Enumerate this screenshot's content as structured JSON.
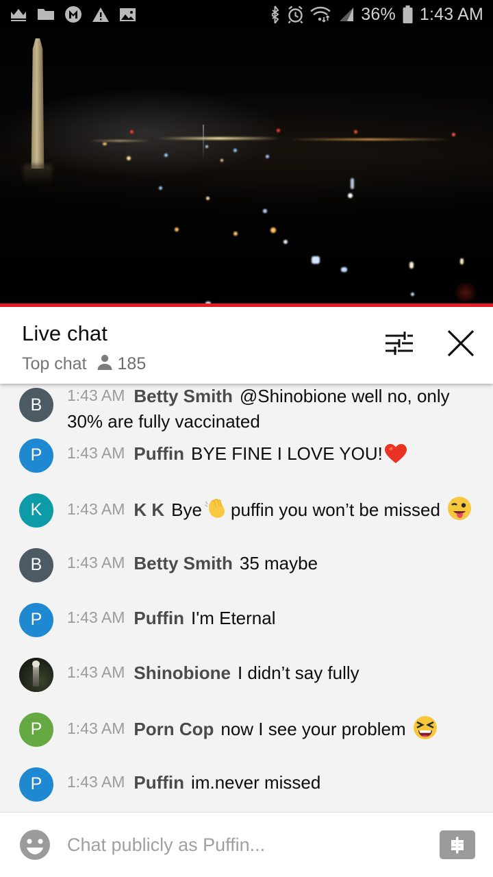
{
  "status_bar": {
    "left_icons": [
      {
        "name": "crown-icon",
        "label": "crown"
      },
      {
        "name": "folder-icon",
        "label": "folder"
      },
      {
        "name": "gmail-icon",
        "label": "M"
      },
      {
        "name": "warning-icon",
        "label": "warning"
      },
      {
        "name": "image-icon",
        "label": "image"
      }
    ],
    "right_icons": [
      {
        "name": "bluetooth-icon",
        "label": "bluetooth"
      },
      {
        "name": "alarm-icon",
        "label": "alarm"
      },
      {
        "name": "wifi-icon",
        "label": "wifi"
      },
      {
        "name": "signal-icon",
        "label": "signal"
      }
    ],
    "battery_percent": "36%",
    "time": "1:43 AM",
    "icon_color": "#b9b9b9",
    "background": "#000000"
  },
  "video": {
    "progress_bar_color": "#ec1d24",
    "description": "night skyline with Washington Monument"
  },
  "chat_header": {
    "title": "Live chat",
    "mode": "Top chat",
    "viewer_count": "185",
    "viewer_icon": "person-icon",
    "settings_icon": "tune-icon",
    "close_icon": "close-icon"
  },
  "messages": [
    {
      "time": "1:43 AM",
      "author": "Betty Smith",
      "text": "@Shinobione well no, only 30% are fully vaccinated",
      "avatar_letter": "B",
      "avatar_color": "#4c5b63",
      "avatar_type": "letter",
      "clipped": true
    },
    {
      "time": "1:43 AM",
      "author": "Puffin",
      "text": "BYE FINE I LOVE YOU!",
      "emoji": "❤️",
      "avatar_letter": "P",
      "avatar_color": "#1e88d0",
      "avatar_type": "letter",
      "clipped": false
    },
    {
      "time": "1:43 AM",
      "author": "K K",
      "text": "Bye",
      "emoji_mid": "👋",
      "text2": "puffin you won’t be missed",
      "emoji": "😜",
      "avatar_letter": "K",
      "avatar_color": "#0e9ba8",
      "avatar_type": "letter",
      "clipped": false
    },
    {
      "time": "1:43 AM",
      "author": "Betty Smith",
      "text": "35 maybe",
      "avatar_letter": "B",
      "avatar_color": "#4c5b63",
      "avatar_type": "letter",
      "clipped": false
    },
    {
      "time": "1:43 AM",
      "author": "Puffin",
      "text": "I'm Eternal",
      "avatar_letter": "P",
      "avatar_color": "#1e88d0",
      "avatar_type": "letter",
      "clipped": false
    },
    {
      "time": "1:43 AM",
      "author": "Shinobione",
      "text": "I didn’t say fully",
      "avatar_letter": "",
      "avatar_color": "#1c1f18",
      "avatar_type": "photo",
      "clipped": false
    },
    {
      "time": "1:43 AM",
      "author": "Porn Cop",
      "text": "now I see your problem",
      "emoji": "😆",
      "avatar_letter": "P",
      "avatar_color": "#64a942",
      "avatar_type": "letter",
      "clipped": false
    },
    {
      "time": "1:43 AM",
      "author": "Puffin",
      "text": "im.never missed",
      "avatar_letter": "P",
      "avatar_color": "#1e88d0",
      "avatar_type": "letter",
      "clipped": false
    }
  ],
  "input_bar": {
    "emoji_icon": "emoji-smiley-icon",
    "placeholder": "Chat publicly as Puffin...",
    "value": "",
    "superchat_icon": "dollar-icon",
    "superchat_color": "#9b9b9b"
  }
}
